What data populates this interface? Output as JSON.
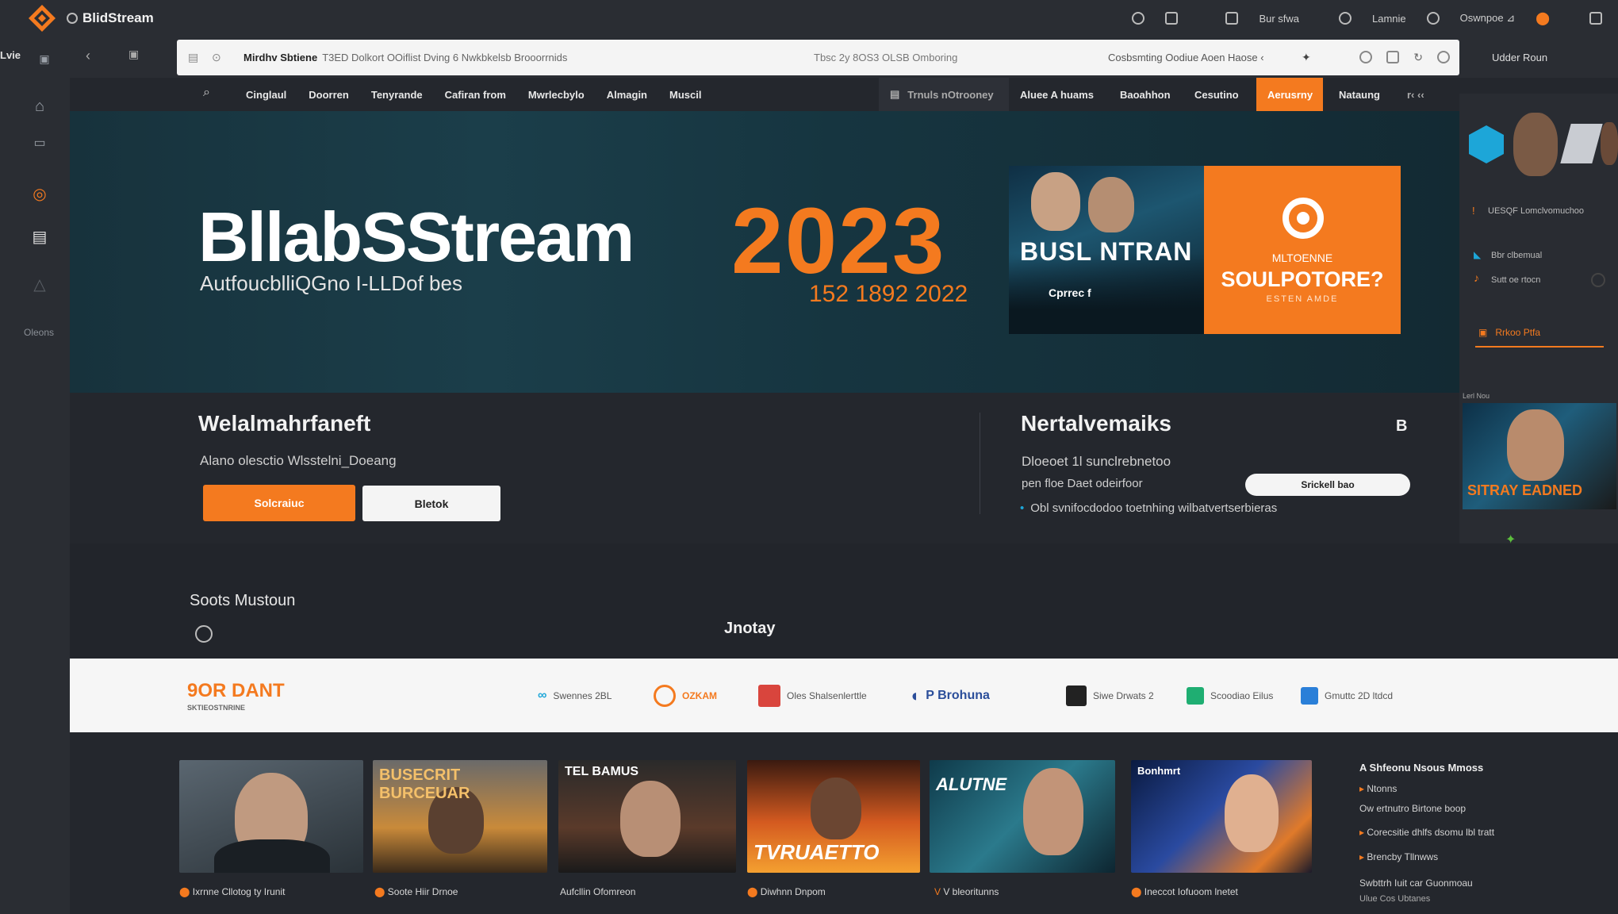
{
  "app": {
    "title": "BlidStream"
  },
  "colors": {
    "accent": "#f47a1f",
    "bg": "#22252b",
    "hero": "#17323c",
    "blue": "#1da6d8"
  },
  "topbar": {
    "right_items": [
      "Bur sfwa",
      "Lamnie",
      "Oswnpoe ⊿"
    ]
  },
  "rail": {
    "label": "Lvie",
    "bottom_label": "Oleons",
    "icons": [
      "home-icon",
      "window-icon",
      "search-icon",
      "display-icon",
      "triangle-icon"
    ]
  },
  "address_bar": {
    "title": "Mirdhv Sbtiene",
    "text": "T3ED Dolkort OOiflist Dving 6 Nwkbkelsb Brooorrnids",
    "middle": "Tbsc 2y 8OS3 OLSB Omboring",
    "right": "Cosbsmting Oodiue Aoen  Haose ‹"
  },
  "side_caption": "Udder  Roun",
  "nav": {
    "items": [
      "Cinglaul",
      "Doorren",
      "Tenyrande",
      "Cafiran from",
      "Mwrlecbylo",
      "Almagin",
      "Muscil"
    ],
    "segments": [
      "Trnuls nOtrooney",
      "Aluee A huams",
      "Baoahhon",
      "Cesutino",
      "Aerusrny",
      "Nataung",
      "r‹ ‹‹"
    ]
  },
  "hero": {
    "title": "BllabSStream",
    "subtitle": "AutfoucblliQGno I-LLDof bes",
    "year": "2023",
    "year_sub": "152 1892 2022",
    "poster1": {
      "title": "BUSL NTRAN",
      "sub": "Cprrec f"
    },
    "poster2": {
      "top": "MLTOENNE",
      "main": "SOULPOTORE?",
      "bottom": "ESTEN AMDE"
    }
  },
  "welcome": {
    "title": "Welalmahrfaneft",
    "text": "Alano  olesctio Wlsstelni_Doeang",
    "primary_button": "Solcraiuc",
    "secondary_button": "Bletok"
  },
  "network": {
    "title": "Nertalvemaiks",
    "badge": "B",
    "line1": "Dloeoet 1l sunclrebnetoo",
    "line2": "pen floe Daet odeirfoor",
    "bullet": "Obl svnifocdodoo toetnhing  wilbatvertserbieras",
    "button": "Srickell bao"
  },
  "sports": {
    "title": "Soots Mustoun",
    "journey": "Jnotay"
  },
  "partners": {
    "brand": "9OR DANT",
    "brand_sub": "SKTIEOSTNRINE",
    "items": [
      "Swennes 2BL",
      "OZKAM",
      "Oles Shalsenlerttle",
      "P Brohuna",
      "Siwe Drwats 2",
      "Scoodiao Eilus",
      "Gmuttc 2D ltdcd"
    ]
  },
  "grid": {
    "cards": [
      {
        "title": "",
        "caption": "Ixrnne Cllotog ty Irunit"
      },
      {
        "title": "BUSECRIT BURCEUAR",
        "caption": "Soote Hiir Drnoe"
      },
      {
        "title": "TEL BAMUS",
        "caption": "Aufcllin Ofomreon"
      },
      {
        "title": "TVRUAETTO",
        "caption": "Diwhnn Dnpom"
      },
      {
        "title": "ALUTNE",
        "caption": "V bleoritunns"
      },
      {
        "title": "Bonhmrt",
        "caption": "Ineccot Iofuoom lnetet"
      }
    ],
    "list_title": "A Shfeonu Nsous Mmoss",
    "list": [
      "Ntonns",
      "Ow ertnutro Birtone boop",
      "Corecsitie dhlfs dsomu lbl tratt",
      "Brencby Tllnwws",
      "Swbttrh Iuit car Guonmoau",
      "Ulue Cos Ubtanes"
    ]
  },
  "right_sidebar": {
    "line1": "UESQF Lomclvomuchoo",
    "line2": "Bbr clbemual",
    "line3": "Sutt oe rtocn",
    "action": "Rrkoo Ptfa",
    "thumb_label": "Lerl Nou",
    "thumb_title": "SITRAY EADNED"
  }
}
